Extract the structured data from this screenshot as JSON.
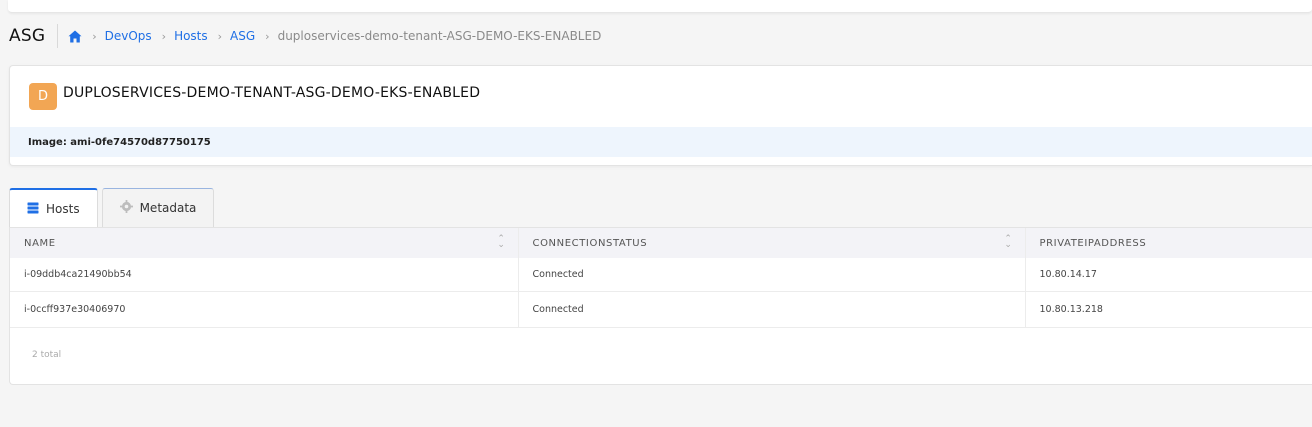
{
  "page": {
    "title": "ASG"
  },
  "breadcrumb": {
    "home_icon": "home-icon",
    "items": [
      "DevOps",
      "Hosts",
      "ASG"
    ],
    "current": "duploservices-demo-tenant-ASG-DEMO-EKS-ENABLED"
  },
  "card": {
    "avatar_letter": "D",
    "avatar_color": "#f2a654",
    "title": "DUPLOSERVICES-DEMO-TENANT-ASG-DEMO-EKS-ENABLED",
    "image_label": "Image: ami-0fe74570d87750175"
  },
  "tabs": [
    {
      "label": "Hosts",
      "icon": "server-icon",
      "active": true
    },
    {
      "label": "Metadata",
      "icon": "gear-icon",
      "active": false
    }
  ],
  "table": {
    "columns": [
      "NAME",
      "CONNECTIONSTATUS",
      "PRIVATEIPADDRESS"
    ],
    "rows": [
      [
        "i-09ddb4ca21490bb54",
        "Connected",
        "10.80.14.17"
      ],
      [
        "i-0ccff937e30406970",
        "Connected",
        "10.80.13.218"
      ]
    ],
    "total": "2 total"
  },
  "colors": {
    "accent": "#1f6fe5"
  }
}
